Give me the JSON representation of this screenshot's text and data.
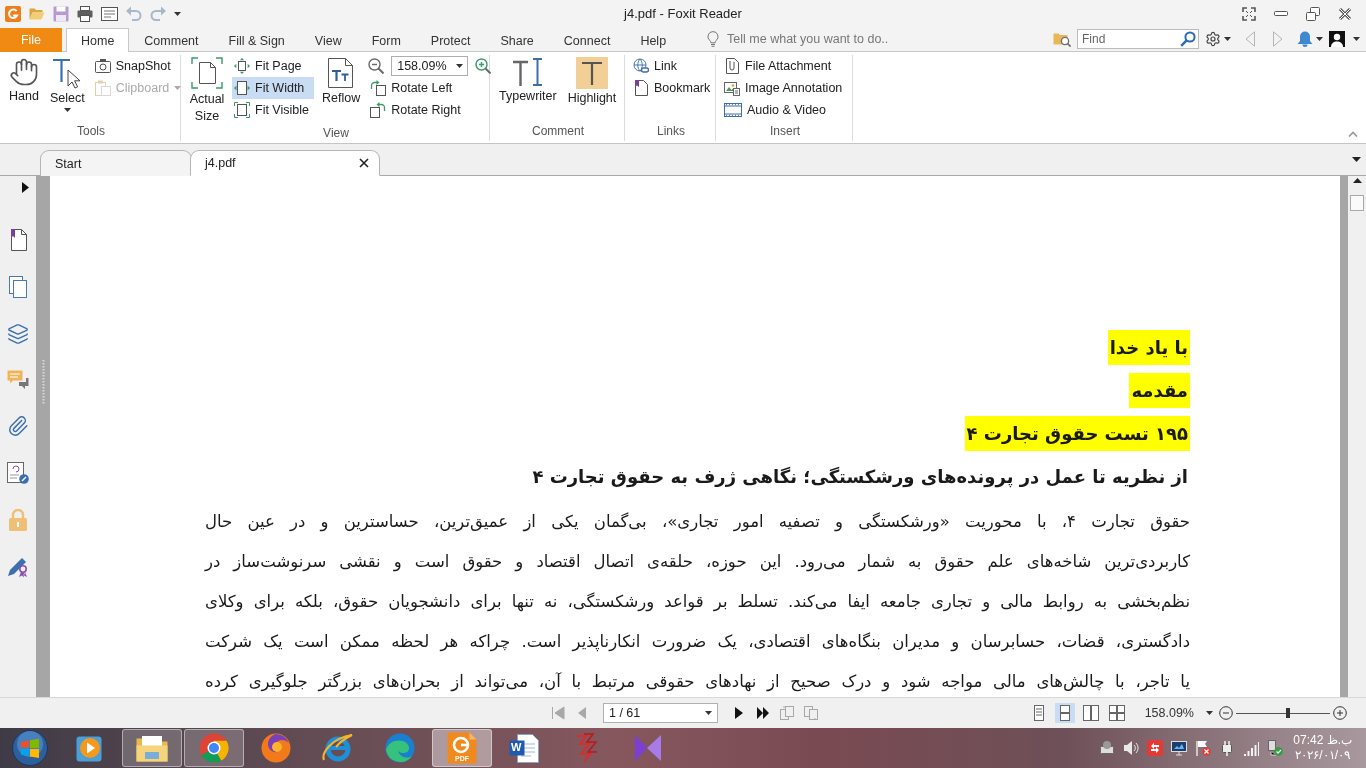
{
  "title_bar": {
    "title": "j4.pdf - Foxit Reader"
  },
  "ribbon": {
    "tabs": [
      {
        "label": "File",
        "kind": "file",
        "selected": false
      },
      {
        "label": "Home",
        "kind": "tab",
        "selected": true
      },
      {
        "label": "Comment",
        "kind": "tab",
        "selected": false
      },
      {
        "label": "Fill & Sign",
        "kind": "tab",
        "selected": false
      },
      {
        "label": "View",
        "kind": "tab",
        "selected": false
      },
      {
        "label": "Form",
        "kind": "tab",
        "selected": false
      },
      {
        "label": "Protect",
        "kind": "tab",
        "selected": false
      },
      {
        "label": "Share",
        "kind": "tab",
        "selected": false
      },
      {
        "label": "Connect",
        "kind": "tab",
        "selected": false
      },
      {
        "label": "Help",
        "kind": "tab",
        "selected": false
      }
    ],
    "tell_me": {
      "placeholder": "Tell me what you want to do.."
    },
    "find": {
      "placeholder": "Find"
    },
    "groups": [
      {
        "label": "Tools",
        "columns": [
          {
            "kind": "large",
            "items": [
              {
                "kind": "button",
                "label": "Hand",
                "selected": false,
                "disabled": false,
                "dropdown": false
              }
            ]
          },
          {
            "kind": "large",
            "items": [
              {
                "kind": "button",
                "label": "Select",
                "selected": false,
                "disabled": false,
                "dropdown": true
              }
            ]
          },
          {
            "kind": "stack",
            "items": [
              {
                "kind": "button",
                "label": "SnapShot",
                "selected": false,
                "disabled": false,
                "dropdown": false
              },
              {
                "kind": "button",
                "label": "Clipboard",
                "selected": false,
                "disabled": true,
                "dropdown": true
              }
            ]
          }
        ]
      },
      {
        "label": "View",
        "columns": [
          {
            "kind": "large",
            "items": [
              {
                "kind": "button",
                "label": "Actual Size",
                "selected": false,
                "disabled": false,
                "dropdown": false
              }
            ]
          },
          {
            "kind": "stack",
            "items": [
              {
                "kind": "button",
                "label": "Fit Page",
                "selected": false,
                "disabled": false,
                "dropdown": false
              },
              {
                "kind": "button",
                "label": "Fit Width",
                "selected": true,
                "disabled": false,
                "dropdown": false
              },
              {
                "kind": "button",
                "label": "Fit Visible",
                "selected": false,
                "disabled": false,
                "dropdown": false
              }
            ]
          },
          {
            "kind": "large",
            "items": [
              {
                "kind": "button",
                "label": "Reflow",
                "selected": false,
                "disabled": false,
                "dropdown": false
              }
            ]
          },
          {
            "kind": "stack",
            "items": [
              {
                "kind": "zoom",
                "value": "158.09%"
              },
              {
                "kind": "button",
                "label": "Rotate Left",
                "selected": false,
                "disabled": false,
                "dropdown": false
              },
              {
                "kind": "button",
                "label": "Rotate Right",
                "selected": false,
                "disabled": false,
                "dropdown": false
              }
            ]
          }
        ]
      },
      {
        "label": "Comment",
        "columns": [
          {
            "kind": "large",
            "items": [
              {
                "kind": "button",
                "label": "Typewriter",
                "selected": false,
                "disabled": false,
                "dropdown": false
              }
            ]
          },
          {
            "kind": "large",
            "items": [
              {
                "kind": "button",
                "label": "Highlight",
                "selected": true,
                "disabled": false,
                "dropdown": false
              }
            ]
          }
        ]
      },
      {
        "label": "Links",
        "columns": [
          {
            "kind": "stack",
            "items": [
              {
                "kind": "button",
                "label": "Link",
                "selected": false,
                "disabled": false,
                "dropdown": false
              },
              {
                "kind": "button",
                "label": "Bookmark",
                "selected": false,
                "disabled": false,
                "dropdown": false
              }
            ]
          }
        ]
      },
      {
        "label": "Insert",
        "columns": [
          {
            "kind": "stack",
            "items": [
              {
                "kind": "button",
                "label": "File Attachment",
                "selected": false,
                "disabled": false,
                "dropdown": false
              },
              {
                "kind": "button",
                "label": "Image Annotation",
                "selected": false,
                "disabled": false,
                "dropdown": false
              },
              {
                "kind": "button",
                "label": "Audio & Video",
                "selected": false,
                "disabled": false,
                "dropdown": false
              }
            ]
          }
        ]
      }
    ]
  },
  "document_tabs": [
    {
      "label": "Start",
      "selected": false,
      "closable": false
    },
    {
      "label": "j4.pdf",
      "selected": true,
      "closable": true
    }
  ],
  "document": {
    "headings": [
      {
        "text": "با یاد خدا",
        "highlighted": true
      },
      {
        "text": "مقدمه",
        "highlighted": true
      },
      {
        "text": "۱۹۵ تست حقوق تجارت ۴",
        "highlighted": true
      },
      {
        "text": "از نظریه تا عمل در پرونده‌های ورشکستگی؛ نگاهی ژرف به حقوق تجارت ۴",
        "highlighted": false
      }
    ],
    "paragraph_lines": [
      "حقوق تجارت ۴، با محوریت «ورشکستگی و تصفیه امور تجاری»، بی‌گمان یکی از عمیق‌ترین، حساسترین و در عین حال",
      "کاربردی‌ترین شاخه‌های علم حقوق به شمار می‌رود. این حوزه، حلقه‌ی اتصال اقتصاد و حقوق است و نقشی سرنوشت‌ساز در",
      "نظم‌بخشی به روابط مالی و تجاری جامعه ایفا می‌کند. تسلط بر قواعد ورشکستگی، نه تنها برای دانشجویان حقوق، بلکه برای وکلای",
      "دادگستری، قضات، حسابرسان و مدیران بنگاه‌های اقتصادی، یک ضرورت انکارناپذیر است. چراکه هر لحظه ممکن است یک شرکت",
      "یا تاجر، با چالش‌های مالی مواجه شود و درک صحیح از نهادهای حقوقی مرتبط با آن، می‌تواند از بحران‌های بزرگتر جلوگیری کرده"
    ]
  },
  "status_bar": {
    "nav": [
      {
        "disabled": true
      },
      {
        "disabled": true
      },
      {
        "disabled": false
      },
      {
        "disabled": false
      },
      {
        "disabled": true
      },
      {
        "disabled": true
      }
    ],
    "page": "1 / 61",
    "view_modes": [
      {
        "selected": false
      },
      {
        "selected": true
      },
      {
        "selected": false
      },
      {
        "selected": false
      }
    ],
    "zoom": "158.09%",
    "zoom_slider": {
      "level": 0.55
    }
  },
  "taskbar": {
    "apps": [
      {
        "kind": "media",
        "open": false,
        "selected": false
      },
      {
        "kind": "folder",
        "open": true,
        "selected": false
      },
      {
        "kind": "segmented",
        "open": true,
        "selected": false
      },
      {
        "kind": "globe",
        "open": false,
        "selected": false
      },
      {
        "kind": "orbit",
        "open": false,
        "selected": false
      },
      {
        "kind": "wave",
        "open": false,
        "selected": false
      },
      {
        "kind": "pdf",
        "badge": "PDF",
        "open": true,
        "selected": true
      },
      {
        "kind": "document",
        "badge": "W",
        "open": false,
        "selected": false
      },
      {
        "kind": "zigzag",
        "open": false,
        "selected": false
      },
      {
        "kind": "bowtie",
        "open": false,
        "selected": false
      }
    ],
    "clock": {
      "time": "07:42 ب.ظ",
      "date": "۲۰۲۶/۰۱/۰۹"
    }
  }
}
